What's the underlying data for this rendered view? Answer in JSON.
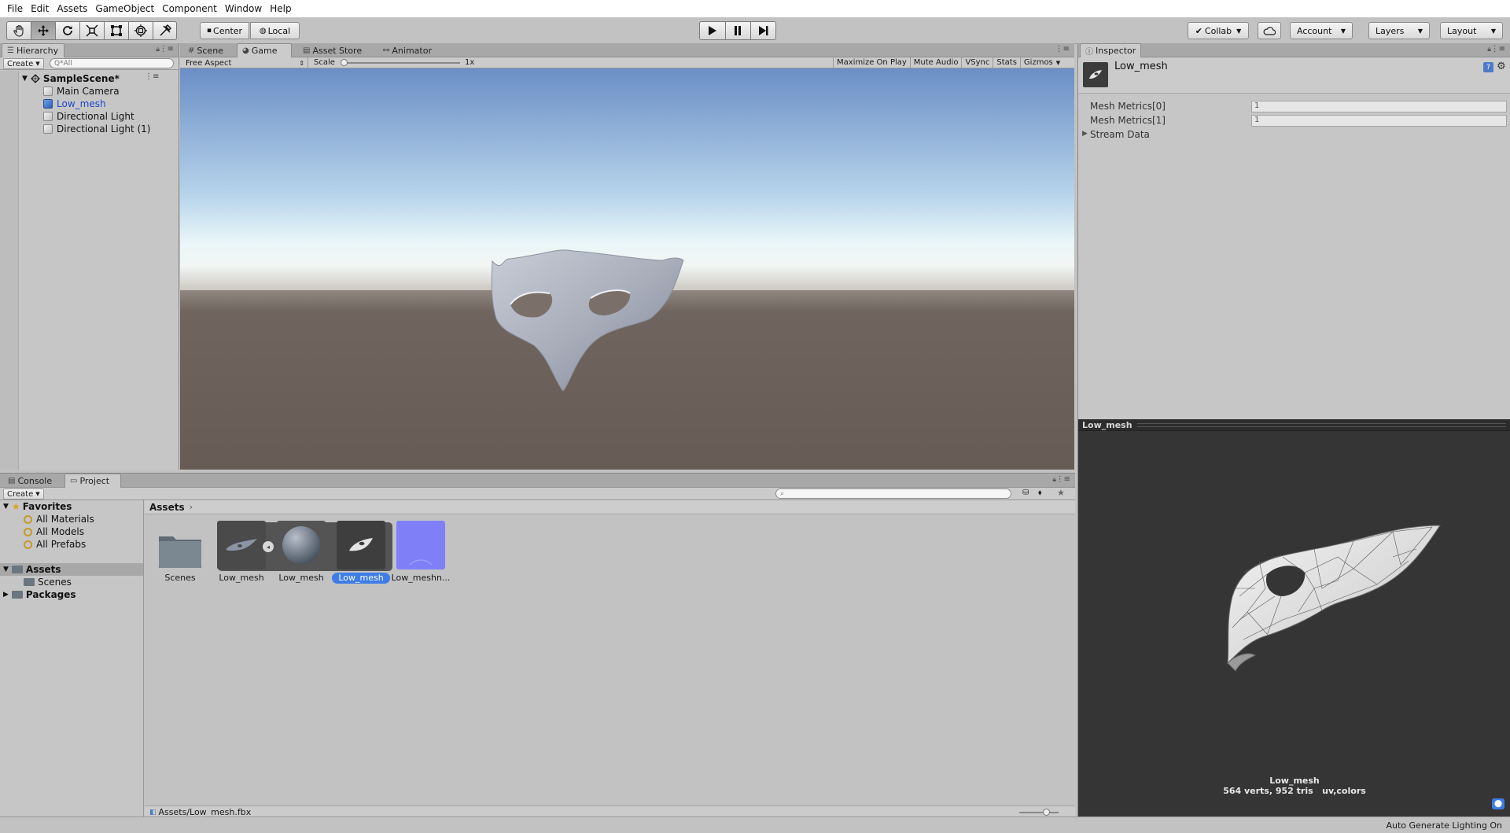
{
  "menu": [
    "File",
    "Edit",
    "Assets",
    "GameObject",
    "Component",
    "Window",
    "Help"
  ],
  "toolbar": {
    "tools": [
      "hand-tool-icon",
      "move-tool-icon",
      "rotate-tool-icon",
      "scale-tool-icon",
      "rect-tool-icon",
      "transform-tool-icon",
      "custom-tool-icon"
    ],
    "pivot_label": "Center",
    "space_label": "Local",
    "collab_label": "Collab",
    "account_label": "Account",
    "layers_label": "Layers",
    "layout_label": "Layout"
  },
  "hierarchy": {
    "tab": "Hierarchy",
    "create": "Create",
    "search_placeholder": "Q*All",
    "scene": "SampleScene*",
    "items": [
      "Main Camera",
      "Low_mesh",
      "Directional Light",
      "Directional Light (1)"
    ],
    "selected_index": 1
  },
  "game": {
    "tabs": [
      "Scene",
      "Game",
      "Asset Store",
      "Animator"
    ],
    "active_tab": "Game",
    "aspect": "Free Aspect",
    "scale_label": "Scale",
    "scale_value": "1x",
    "options": [
      "Maximize On Play",
      "Mute Audio",
      "VSync",
      "Stats",
      "Gizmos"
    ]
  },
  "inspector": {
    "tab": "Inspector",
    "object_name": "Low_mesh",
    "rows": [
      {
        "label": "Mesh Metrics[0]",
        "value": "1"
      },
      {
        "label": "Mesh Metrics[1]",
        "value": "1"
      }
    ],
    "foldout": "Stream Data"
  },
  "preview": {
    "header": "Low_mesh",
    "name": "Low_mesh",
    "stats": "564 verts, 952 tris   uv,colors"
  },
  "bottom": {
    "tabs": [
      "Console",
      "Project"
    ],
    "active_tab": "Project",
    "create": "Create",
    "favorites_label": "Favorites",
    "favorites": [
      "All Materials",
      "All Models",
      "All Prefabs"
    ],
    "assets_label": "Assets",
    "assets_children": [
      "Scenes"
    ],
    "packages_label": "Packages",
    "breadcrumb": "Assets",
    "assets": [
      "Scenes",
      "Low_mesh",
      "Low_mesh",
      "Low_mesh",
      "Low_meshn..."
    ],
    "selected_asset": 3,
    "path": "Assets/Low_mesh.fbx"
  },
  "status": {
    "right": "Auto Generate Lighting On"
  },
  "colors": {
    "selection": "#3e7de7",
    "sky_top": "#6b8fc6",
    "horizon": "#e8f4f8",
    "ground": "#6a5f58",
    "preview_bg": "#353535"
  }
}
